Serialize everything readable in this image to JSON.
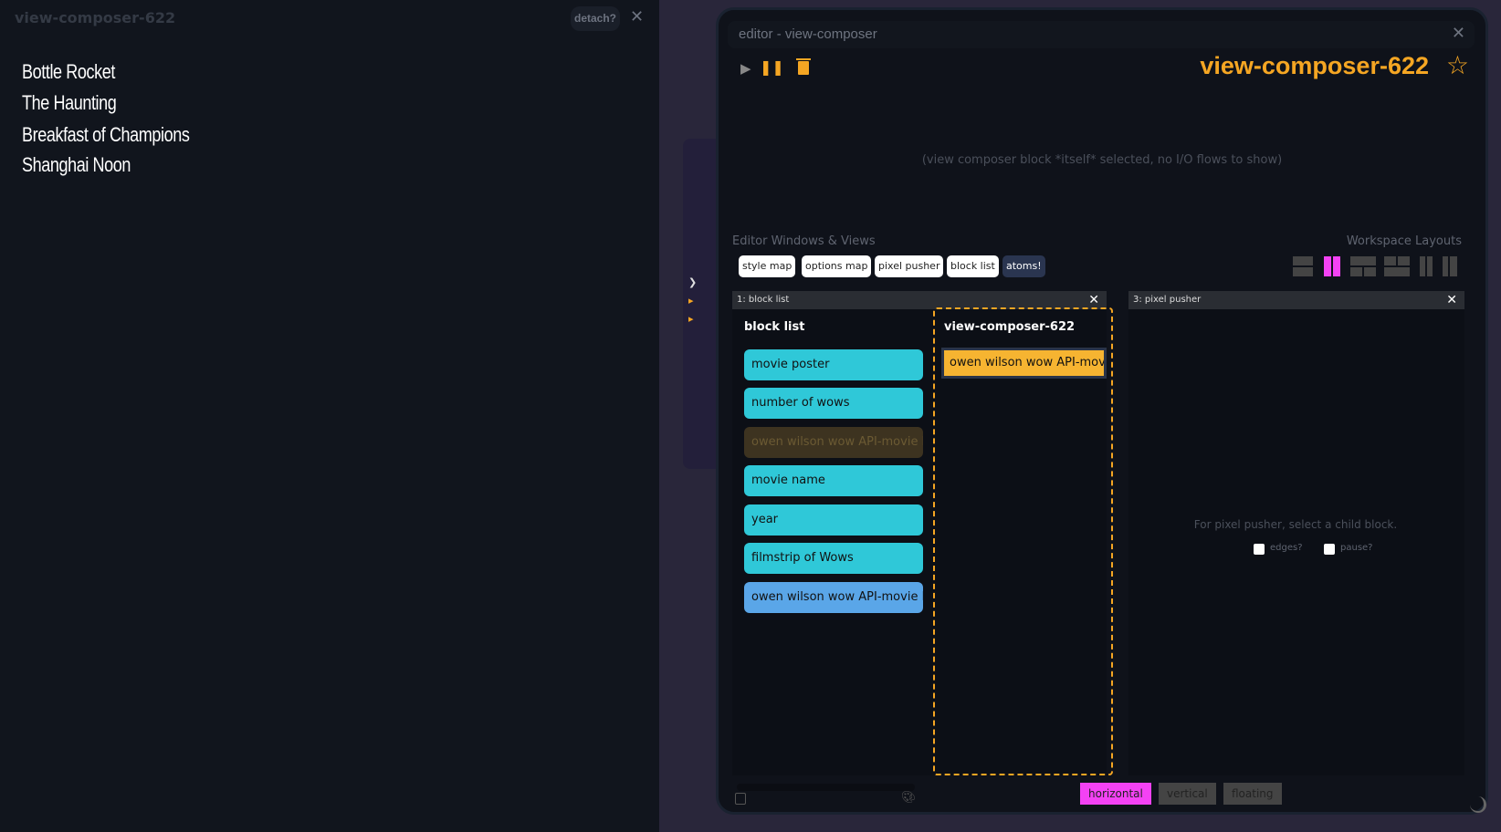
{
  "left_panel": {
    "title": "view-composer-622",
    "detach_label": "detach?",
    "close": "✕",
    "movies": [
      "Bottle Rocket",
      "The Haunting",
      "Breakfast of Champions",
      "Shanghai Noon"
    ]
  },
  "editor": {
    "window_title": "editor - view-composer",
    "close": "✕",
    "block_name": "view-composer-622",
    "io_message": "(view composer block *itself* selected, no I/O flows to show)",
    "views_heading": "Editor Windows & Views",
    "layouts_heading": "Workspace Layouts",
    "view_buttons": [
      "style map",
      "options map",
      "pixel pusher",
      "block list",
      "atoms!"
    ],
    "panes": [
      {
        "header": "1: block list",
        "close": "✕"
      },
      {
        "header": "3: pixel pusher",
        "close": "✕"
      }
    ],
    "block_list": {
      "title": "block list",
      "items": [
        {
          "label": "movie poster",
          "color": "#2fc8d8"
        },
        {
          "label": "number of wows",
          "color": "#2fc8d8"
        },
        {
          "label": "owen wilson wow API-movie list",
          "color": "#3d3320"
        },
        {
          "label": "movie name",
          "color": "#2fc8d8"
        },
        {
          "label": "year",
          "color": "#2fc8d8"
        },
        {
          "label": "filmstrip of Wows",
          "color": "#2fc8d8"
        },
        {
          "label": "owen wilson wow API-movie loader",
          "color": "#5aa6e8"
        }
      ]
    },
    "composer": {
      "title": "view-composer-622",
      "selected_child": "owen wilson wow API-movie list x"
    },
    "pixel_pusher": {
      "message": "For pixel pusher, select a child block.",
      "edges_label": "edges?",
      "pause_label": "pause?",
      "edges": false,
      "pause": false
    },
    "orientation": {
      "options": [
        "horizontal",
        "vertical",
        "floating"
      ],
      "selected": "horizontal"
    },
    "colors": {
      "accent": "#f5a623",
      "active_layout": "#f442f4"
    }
  }
}
